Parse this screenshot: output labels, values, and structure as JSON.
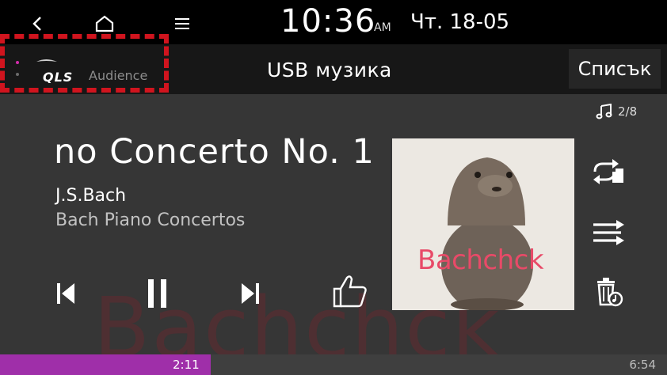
{
  "status": {
    "time": "10:36",
    "ampm": "AM",
    "date": "Чт. 18-05"
  },
  "header": {
    "badge_brand": "QLS",
    "badge_label": "Audience",
    "title": "USB музика",
    "list_button": "Списък"
  },
  "player": {
    "track_counter": "2/8",
    "title": "no Concerto No. 1",
    "artist": "J.S.Bach",
    "album": "Bach Piano Concertos",
    "cover_text": "Bachchck",
    "elapsed": "2:11",
    "total": "6:54",
    "progress": 0.316
  },
  "colors": {
    "accent": "#9f2fa9",
    "highlight_border": "#d0141e",
    "cover_text": "#e84a68"
  },
  "icons": [
    "back-icon",
    "home-icon",
    "menu-icon",
    "music-note-icon",
    "previous-icon",
    "pause-icon",
    "next-icon",
    "thumbs-up-icon",
    "repeat-icon",
    "shuffle-icon",
    "delete-icon"
  ]
}
